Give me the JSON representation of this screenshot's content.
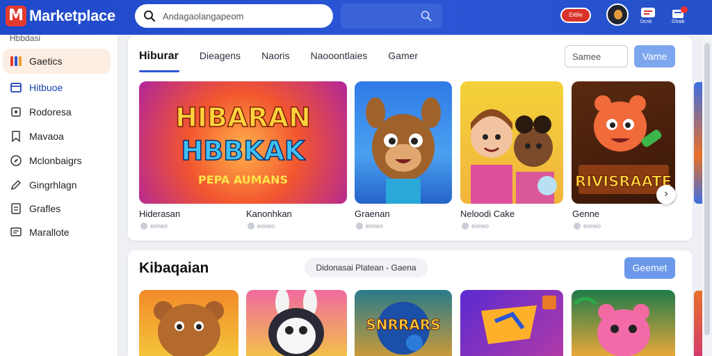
{
  "header": {
    "logo_mark": "M",
    "logo_text": "Marketplace",
    "search_placeholder": "Andagaolangapeom",
    "badge_text": "Eittlle",
    "icons": [
      {
        "name": "help-icon",
        "label": "Dcnb"
      },
      {
        "name": "cart-icon",
        "label": "Ghaib"
      }
    ]
  },
  "sidebar": {
    "top_label": "Hbbdasi",
    "items": [
      {
        "label": "Gaetics",
        "icon": "games-icon",
        "active": true
      },
      {
        "label": "Hitbuoe",
        "icon": "home-icon"
      },
      {
        "label": "Rodoresa",
        "icon": "cart-icon"
      },
      {
        "label": "Mavaoa",
        "icon": "bookmark-icon"
      },
      {
        "label": "Mclonbaigrs",
        "icon": "compass-icon"
      },
      {
        "label": "Gingrhlagn",
        "icon": "pencil-icon"
      },
      {
        "label": "Grafles",
        "icon": "list-icon"
      },
      {
        "label": "Marallote",
        "icon": "chat-icon"
      }
    ]
  },
  "panel1": {
    "tabs": [
      "Hiburar",
      "Dieagens",
      "Naoris",
      "Naooontlaies",
      "Gamer"
    ],
    "filter_placeholder": "Samee",
    "name_button": "Vame",
    "cards": [
      {
        "title": "Hiderasan",
        "meta": "eoneo",
        "image_title": "HIBARAN",
        "image_title2": "HBBKAK",
        "image_subtitle": "PEPA AUMANS"
      },
      {
        "title": "Kanonhkan",
        "meta": "eoneo"
      },
      {
        "title": "Graenan",
        "meta": "eoneo"
      },
      {
        "title": "Neloodi Cake",
        "meta": "eoneo"
      },
      {
        "title": "Genne",
        "meta": "eoneo",
        "image_title": "RIVISRAATE"
      }
    ]
  },
  "panel2": {
    "title": "Kibaqaian",
    "breadcrumb": "Didonasai Platean - Gaena",
    "search_button": "Geemet",
    "card_titles": [
      "",
      "",
      "SNRRARS",
      "",
      ""
    ]
  },
  "colors": {
    "header_blue": "#2a56d6",
    "accent_blue": "#7da6ee",
    "logo_red": "#e43b2f"
  }
}
